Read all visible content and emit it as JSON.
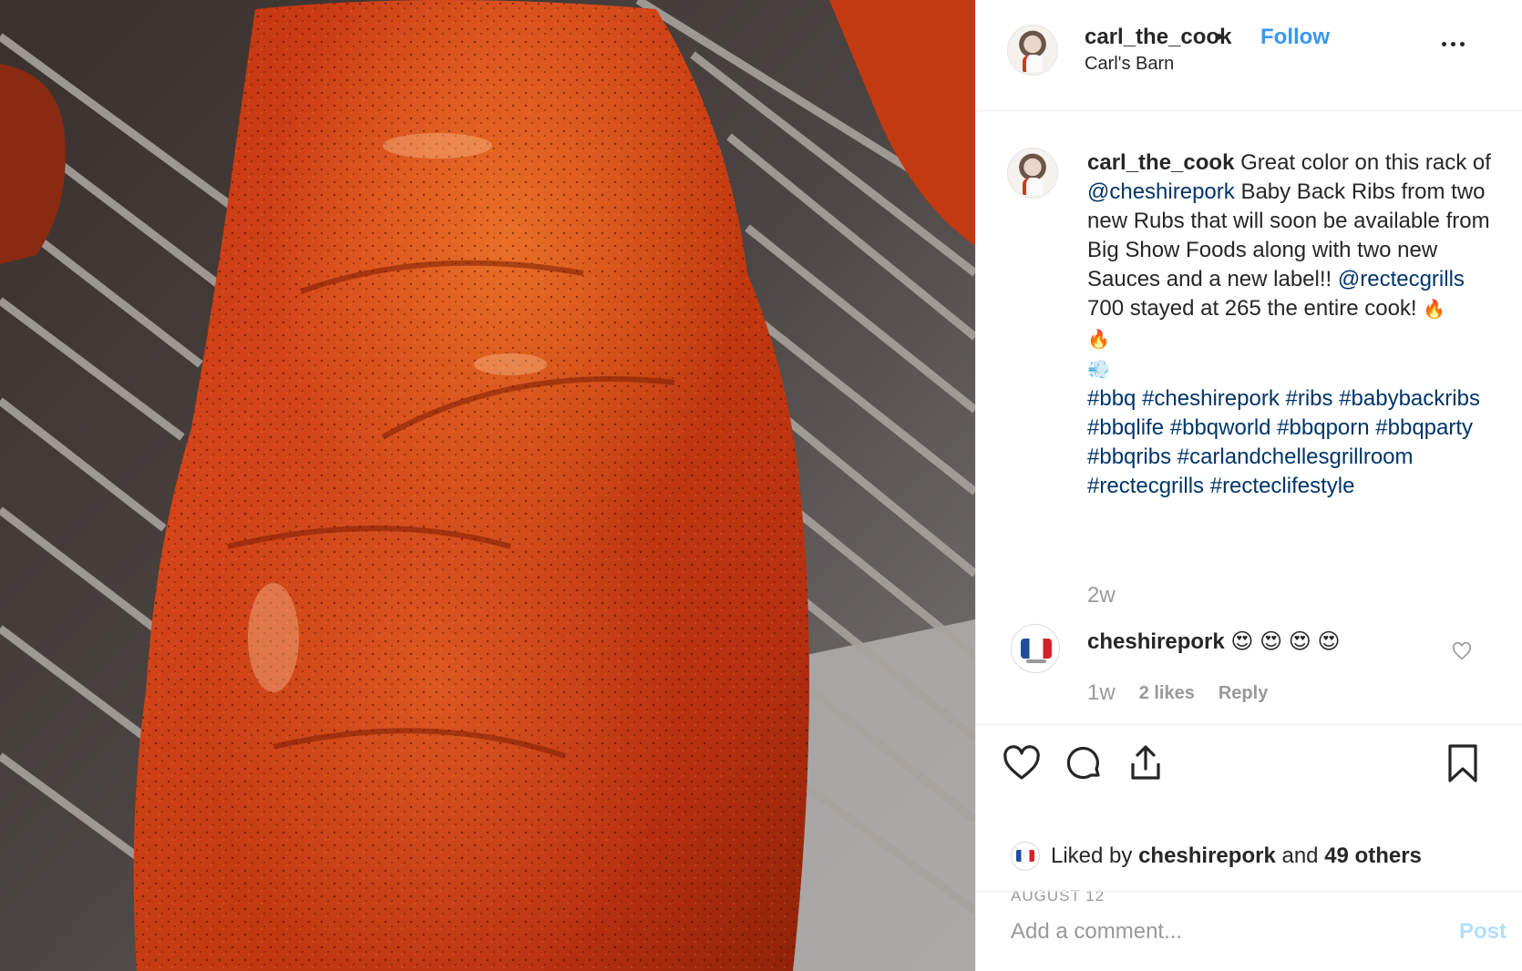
{
  "post": {
    "author": "carl_the_cook",
    "separator": "•",
    "follow_label": "Follow",
    "location": "Carl's Barn",
    "more_icon": "more-options-icon"
  },
  "caption": {
    "username": "carl_the_cook",
    "text_1": "Great color on this rack of",
    "mention_1": "@cheshirepork",
    "text_2": "Baby Back Ribs from two new Rubs that will soon be available from Big Show Foods along with two new Sauces and a new label!!",
    "mention_2": "@rectecgrills",
    "text_3": "700 stayed at 265 the entire cook!",
    "emoji_fire": "🔥",
    "emoji_dash": "💨",
    "hashtags": [
      "#bbq",
      "#cheshirepork",
      "#ribs",
      "#babybackribs",
      "#bbqlife",
      "#bbqworld",
      "#bbqporn",
      "#bbqparty",
      "#bbqribs",
      "#carlandchellesgrillroom",
      "#rectecgrills",
      "#recteclifestyle"
    ],
    "time_ago": "2w"
  },
  "comment": {
    "username": "cheshirepork",
    "text": "😍 😍 😍 😍",
    "time": "1w",
    "likes": "2 likes",
    "reply_label": "Reply"
  },
  "actions": {
    "liked_by_prefix": "Liked by",
    "liked_by_user": "cheshirepork",
    "liked_by_and": "and",
    "liked_by_others": "49 others",
    "date": "AUGUST 12"
  },
  "add_comment": {
    "placeholder": "Add a comment...",
    "post_label": "Post"
  },
  "colors": {
    "link_blue": "#3897f0",
    "mention_navy": "#003569",
    "muted_gray": "#999999",
    "post_disabled": "#b2dffc"
  }
}
